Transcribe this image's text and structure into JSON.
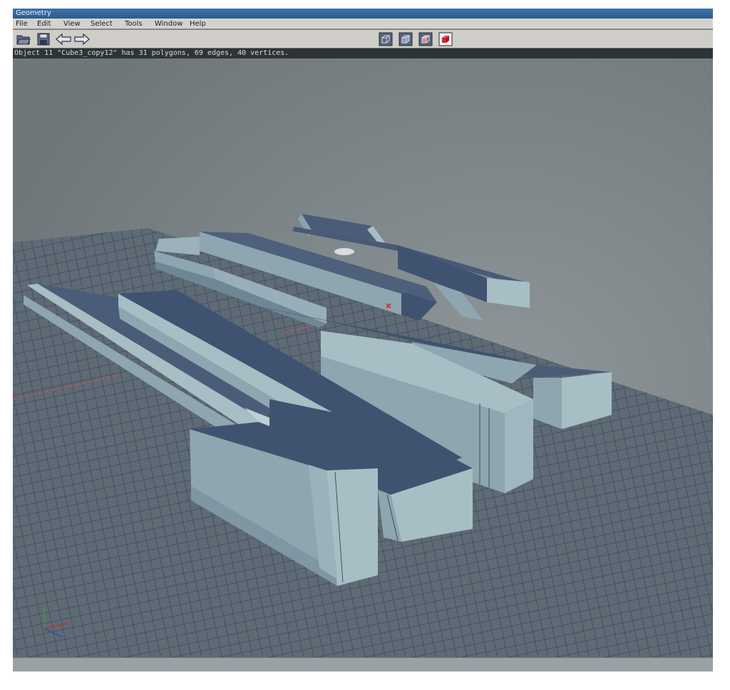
{
  "window": {
    "title": "Geometry"
  },
  "menu": {
    "items": [
      "File",
      "Edit",
      "View",
      "Select",
      "Tools",
      "Window",
      "Help"
    ]
  },
  "toolbar": {
    "left_icons": [
      "open-folder-icon",
      "save-disk-icon",
      "undo-arrow-icon",
      "redo-arrow-icon"
    ],
    "view_mode_icons": [
      "wireframe-cube-icon",
      "hidden-line-cube-icon",
      "flat-shaded-cube-icon",
      "solid-red-cube-icon"
    ],
    "active_view_mode": 3
  },
  "status": {
    "message": "Object 11 \"Cube3_copy12\" has 31 polygons, 69 edges, 40 vertices."
  },
  "viewport": {
    "background_color": "#7c8488",
    "grid_color": "#3c4a5e",
    "model_light_color": "#a7bec5",
    "model_dark_color": "#3f5270",
    "axis_colors": {
      "x": "#c83030",
      "y": "#3a9a3a",
      "z": "#3a4ab0"
    }
  },
  "colors": {
    "title_bar": "#2d5b8f",
    "menu_bar": "#d4d2cc",
    "status_bar": "#2e3337",
    "active_mode": "#d8242c"
  }
}
